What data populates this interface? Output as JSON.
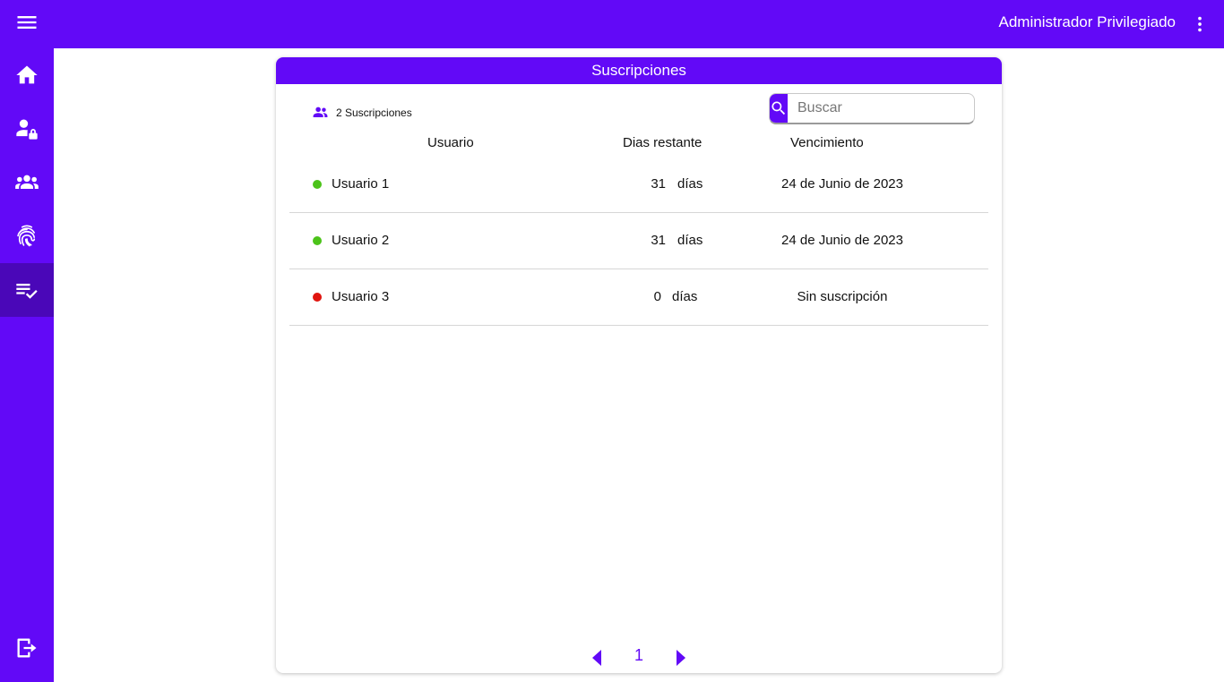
{
  "topbar": {
    "user_name": "Administrador Privilegiado"
  },
  "sidebar": {
    "items": [
      {
        "icon": "menu-icon"
      },
      {
        "icon": "home-icon"
      },
      {
        "icon": "user-lock-icon"
      },
      {
        "icon": "group-icon"
      },
      {
        "icon": "fingerprint-icon"
      },
      {
        "icon": "checklist-icon",
        "active": true
      },
      {
        "icon": "logout-icon"
      }
    ]
  },
  "card": {
    "title": "Suscripciones",
    "count_label": "2 Suscripciones",
    "search": {
      "placeholder": "Buscar",
      "value": ""
    },
    "columns": {
      "user": "Usuario",
      "days": "Dias restante",
      "expiry": "Vencimiento"
    },
    "rows": [
      {
        "status": "active",
        "status_color": "#4cc31a",
        "user": "Usuario 1",
        "days": "31",
        "days_unit": "días",
        "expiry": "24 de Junio de 2023"
      },
      {
        "status": "active",
        "status_color": "#4cc31a",
        "user": "Usuario 2",
        "days": "31",
        "days_unit": "días",
        "expiry": "24 de Junio de 2023"
      },
      {
        "status": "inactive",
        "status_color": "#e0150f",
        "user": "Usuario 3",
        "days": "0",
        "days_unit": "días",
        "expiry": "Sin suscripción"
      }
    ],
    "pagination": {
      "current_page": "1"
    }
  },
  "colors": {
    "brand": "#6209f7",
    "active_nav": "#4a07b8",
    "status_ok": "#4cc31a",
    "status_none": "#e0150f"
  }
}
